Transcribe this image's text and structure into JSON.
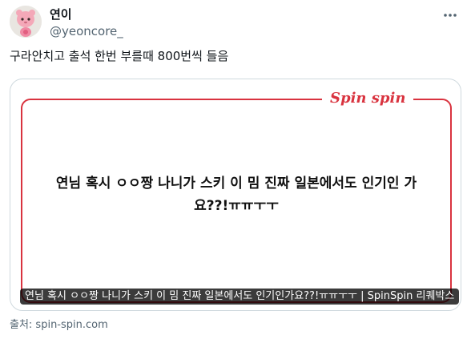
{
  "author": {
    "display_name": "연이",
    "handle": "@yeoncore_",
    "avatar_icon": "pink-character-avatar"
  },
  "more_icon": "more-horizontal-icon",
  "tweet_text": "구라안치고 출석 한번 부를때 800번씩 들음",
  "card": {
    "brand": "Spin spin",
    "question": "연님 혹시 ㅇㅇ짱 나니가 스키 이 밈 진짜 일본에서도 인기인 가요??!ㅠㅠㅜㅜ",
    "title": "연님 혹시 ㅇㅇ짱 나니가 스키 이 밈 진짜 일본에서도 인기인가요??!ㅠㅠㅜㅜ | SpinSpin 리퀘박스"
  },
  "source": "출처: spin-spin.com",
  "colors": {
    "brand_red": "#d9333f",
    "text_primary": "#0f1419",
    "text_secondary": "#536471",
    "card_border": "#cfd9de"
  }
}
